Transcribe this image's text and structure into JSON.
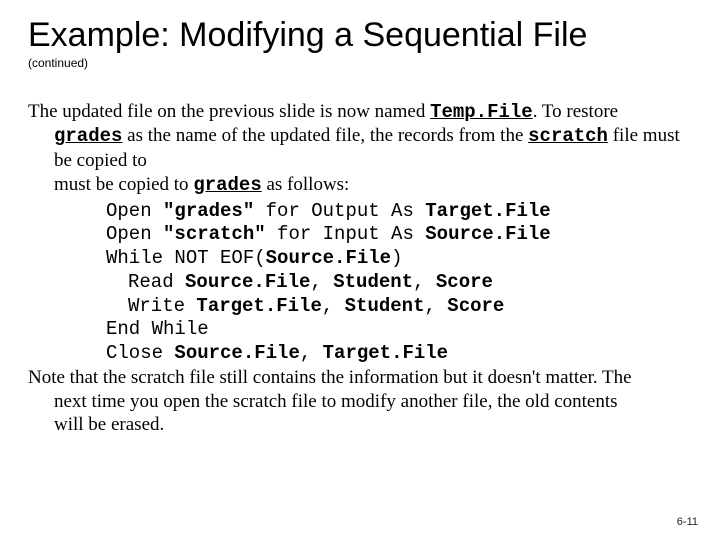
{
  "title": "Example: Modifying a Sequential File",
  "subtitle": "(continued)",
  "intro": {
    "t1": "The updated file on the previous slide is now named ",
    "tempfile": "Temp.File",
    "t2": ". To restore ",
    "grades1": "grades",
    "t3": " as the name of the updated file, the records from the ",
    "scratch": "scratch",
    "t4": " file must be copied to ",
    "grades2": "grades",
    "t5": " as follows:"
  },
  "code": {
    "l1_a": "Open ",
    "l1_b": "\"grades\"",
    "l1_c": " for Output As ",
    "l1_d": "Target.File",
    "l2_a": "Open ",
    "l2_b": "\"scratch\"",
    "l2_c": " for Input As ",
    "l2_d": "Source.File",
    "l3_a": "While NOT EOF(",
    "l3_b": "Source.File",
    "l3_c": ")",
    "l4_a": "Read ",
    "l4_b": "Source.File",
    "l4_c": ", ",
    "l4_d": "Student",
    "l4_e": ", ",
    "l4_f": "Score",
    "l5_a": "Write ",
    "l5_b": "Target.File",
    "l5_c": ", ",
    "l5_d": "Student",
    "l5_e": ", ",
    "l5_f": "Score",
    "l6": "End While",
    "l7_a": "Close ",
    "l7_b": "Source.File",
    "l7_c": ", ",
    "l7_d": "Target.File"
  },
  "note": {
    "n1": "Note that the scratch file still contains the information but it doesn't matter. The next time you open the scratch file to modify another file, the old contents will be erased."
  },
  "footer": "6-11"
}
